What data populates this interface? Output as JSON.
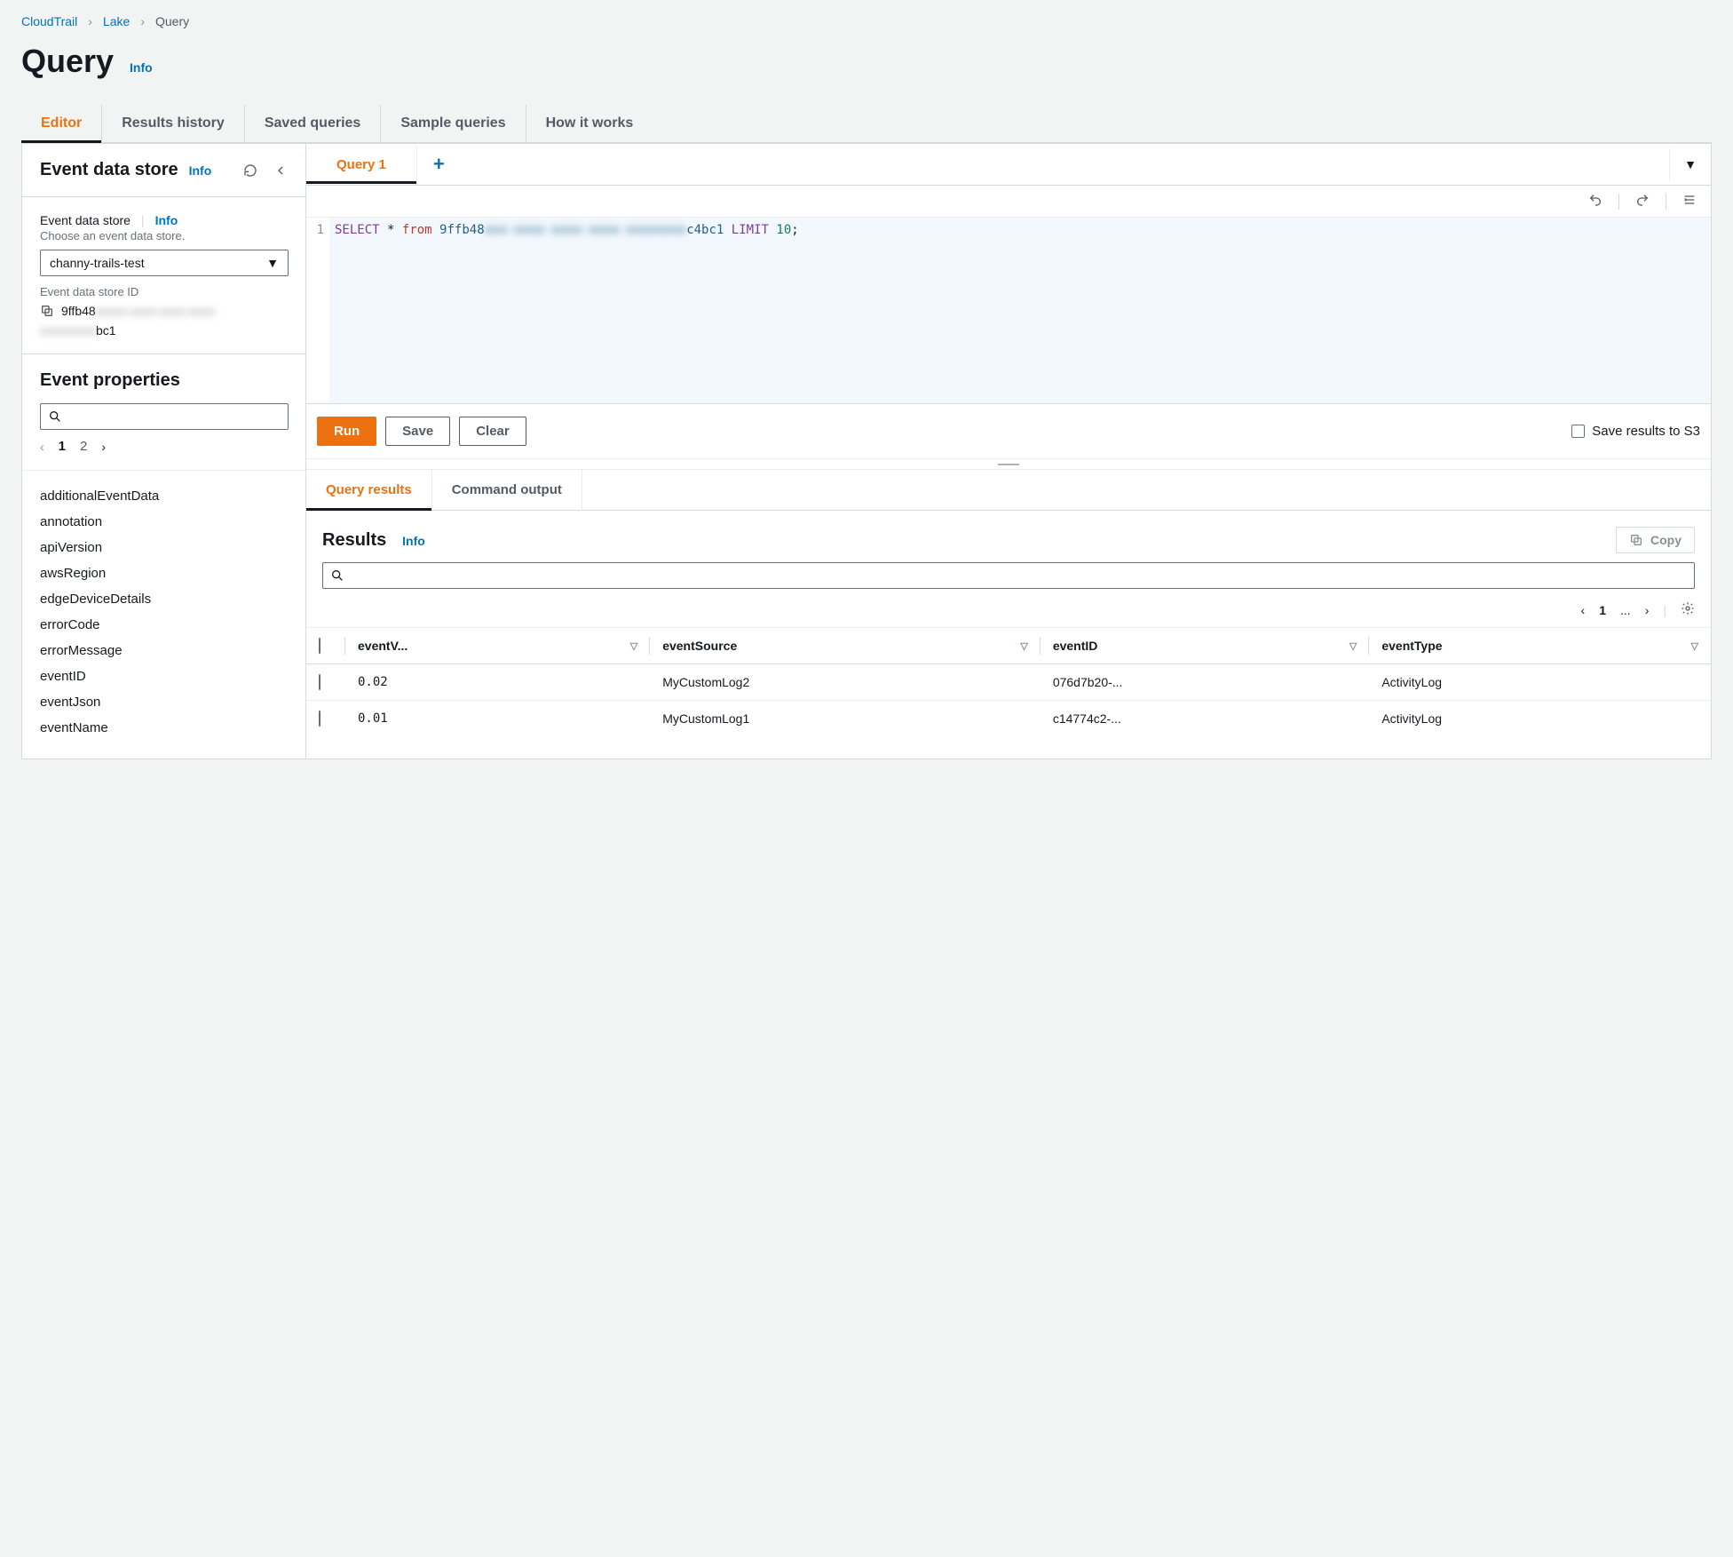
{
  "breadcrumb": {
    "items": [
      "CloudTrail",
      "Lake",
      "Query"
    ]
  },
  "page": {
    "title": "Query",
    "info": "Info"
  },
  "tabs": {
    "items": [
      "Editor",
      "Results history",
      "Saved queries",
      "Sample queries",
      "How it works"
    ],
    "active": 0
  },
  "eds_panel": {
    "title": "Event data store",
    "info": "Info",
    "field_label": "Event data store",
    "field_info": "Info",
    "field_desc": "Choose an event data store.",
    "selected": "channy-trails-test",
    "id_label": "Event data store ID",
    "id_prefix": "9ffb48",
    "id_hidden": "xxxxx-xxxx-xxxx-xxxx-",
    "id_hidden2": "xxxxxxxxx",
    "id_suffix": "bc1"
  },
  "props_panel": {
    "title": "Event properties",
    "pages": [
      "1",
      "2"
    ],
    "items": [
      "additionalEventData",
      "annotation",
      "apiVersion",
      "awsRegion",
      "edgeDeviceDetails",
      "errorCode",
      "errorMessage",
      "eventID",
      "eventJson",
      "eventName"
    ]
  },
  "query_tabs": {
    "items": [
      "Query 1"
    ],
    "active": 0,
    "add": "+"
  },
  "editor": {
    "line_num": "1",
    "tokens": {
      "select": "SELECT",
      "star": "*",
      "from": "from",
      "id_prefix": "9ffb48",
      "id_hidden": "xxx-xxxx-xxxx-xxxx-xxxxxxxx",
      "id_suffix": "c4bc1",
      "limit": "LIMIT",
      "num": "10",
      "semi": ";"
    }
  },
  "actions": {
    "run": "Run",
    "save": "Save",
    "clear": "Clear",
    "save_s3": "Save results to S3"
  },
  "result_tabs": {
    "items": [
      "Query results",
      "Command output"
    ],
    "active": 0
  },
  "results": {
    "title": "Results",
    "info": "Info",
    "copy": "Copy",
    "page": "1",
    "ellipsis": "...",
    "columns": [
      "eventV...",
      "eventSource",
      "eventID",
      "eventType"
    ],
    "rows": [
      {
        "eventVersion": "0.02",
        "eventSource": "MyCustomLog2",
        "eventID": "076d7b20-...",
        "eventType": "ActivityLog"
      },
      {
        "eventVersion": "0.01",
        "eventSource": "MyCustomLog1",
        "eventID": "c14774c2-...",
        "eventType": "ActivityLog"
      }
    ]
  }
}
